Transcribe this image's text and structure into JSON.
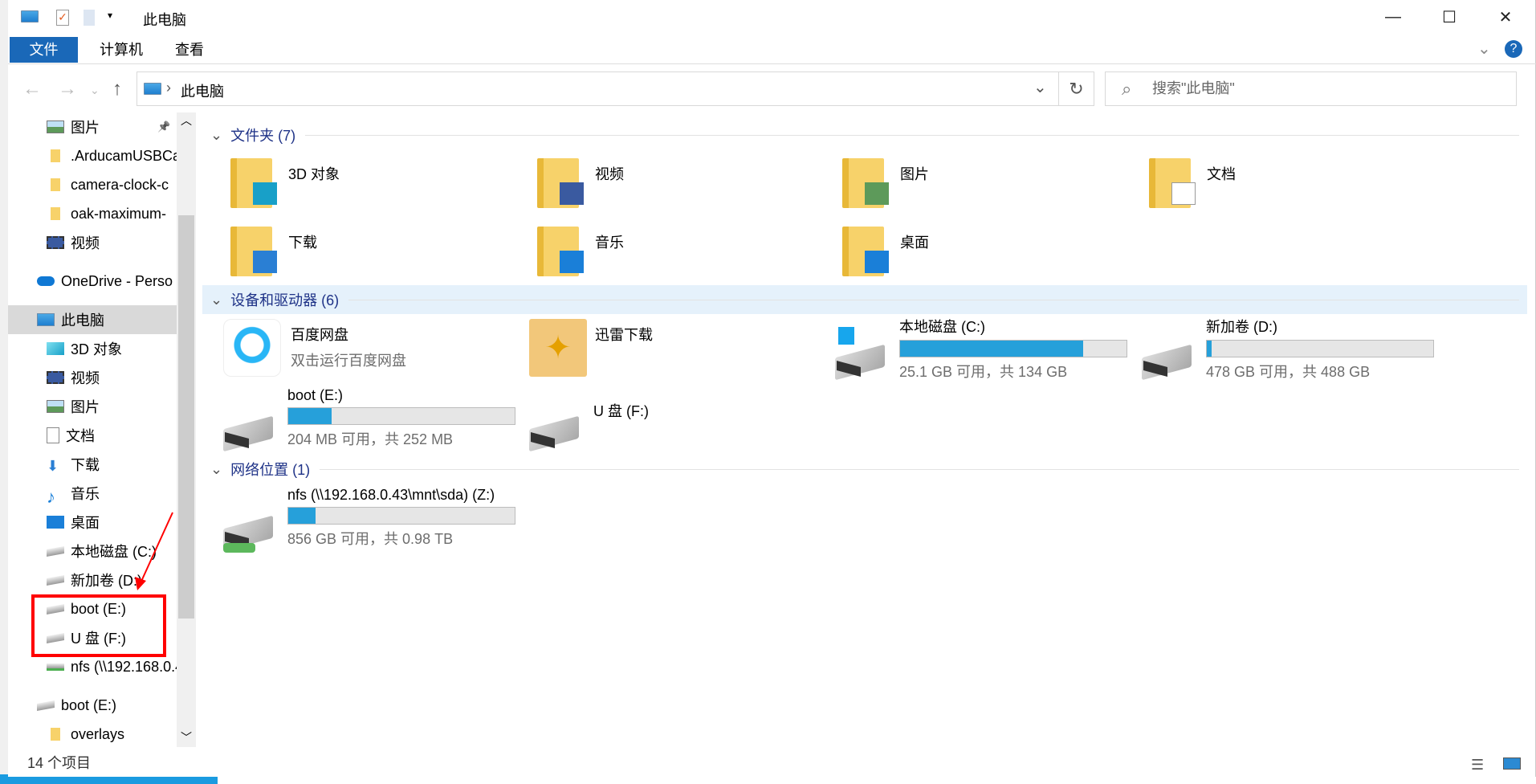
{
  "window": {
    "title": "此电脑",
    "minimize": "—",
    "maximize": "☐",
    "close": "✕"
  },
  "ribbon": {
    "tabs": [
      "文件",
      "计算机",
      "查看"
    ],
    "help": "?",
    "expand": "⌄"
  },
  "address": {
    "path": "此电脑",
    "separator": "›",
    "dropdown": "⌄",
    "refresh": "↻",
    "back": "←",
    "forward": "→",
    "recent": "⌄",
    "up": "↑"
  },
  "search": {
    "placeholder": "搜索\"此电脑\"",
    "icon": "⌕"
  },
  "nav": [
    {
      "label": "图片",
      "icon": "pictures-icon",
      "type": "sub",
      "pinned": true
    },
    {
      "label": ".ArducamUSBCa",
      "icon": "folder-icon",
      "type": "sub"
    },
    {
      "label": "camera-clock-c",
      "icon": "folder-icon",
      "type": "sub"
    },
    {
      "label": "oak-maximum-",
      "icon": "folder-icon",
      "type": "sub"
    },
    {
      "label": "视频",
      "icon": "videos-icon",
      "type": "sub"
    },
    {
      "label": "OneDrive - Perso",
      "icon": "onedrive-icon",
      "type": "root"
    },
    {
      "label": "此电脑",
      "icon": "pc-icon",
      "type": "root",
      "selected": true
    },
    {
      "label": "3D 对象",
      "icon": "3d-objects-icon",
      "type": "sub"
    },
    {
      "label": "视频",
      "icon": "videos-icon",
      "type": "sub"
    },
    {
      "label": "图片",
      "icon": "pictures-icon",
      "type": "sub"
    },
    {
      "label": "文档",
      "icon": "documents-icon",
      "type": "sub"
    },
    {
      "label": "下载",
      "icon": "downloads-icon",
      "type": "sub"
    },
    {
      "label": "音乐",
      "icon": "music-icon",
      "type": "sub"
    },
    {
      "label": "桌面",
      "icon": "desktop-icon",
      "type": "sub"
    },
    {
      "label": "本地磁盘 (C:)",
      "icon": "drive-icon",
      "type": "sub"
    },
    {
      "label": "新加卷 (D:)",
      "icon": "drive-icon",
      "type": "sub"
    },
    {
      "label": "boot (E:)",
      "icon": "drive-icon",
      "type": "sub"
    },
    {
      "label": "U 盘 (F:)",
      "icon": "drive-icon",
      "type": "sub"
    },
    {
      "label": "nfs (\\\\192.168.0.43\\mnt\\sda) (Z:)",
      "icon": "network-drive-icon",
      "type": "sub"
    },
    {
      "label": "boot (E:)",
      "icon": "drive-icon",
      "type": "root"
    },
    {
      "label": "overlays",
      "icon": "folder-icon",
      "type": "sub"
    }
  ],
  "sections": {
    "folders": {
      "title": "文件夹 (7)",
      "items": [
        "3D 对象",
        "视频",
        "图片",
        "文档",
        "下载",
        "音乐",
        "桌面"
      ]
    },
    "devices": {
      "title": "设备和驱动器 (6)"
    },
    "network": {
      "title": "网络位置 (1)"
    }
  },
  "apps": [
    {
      "name": "百度网盘",
      "sub": "双击运行百度网盘"
    },
    {
      "name": "迅雷下载"
    }
  ],
  "drives": [
    {
      "name": "本地磁盘 (C:)",
      "info": "25.1 GB 可用，共 134 GB",
      "used_pct": 81
    },
    {
      "name": "新加卷 (D:)",
      "info": "478 GB 可用，共 488 GB",
      "used_pct": 2
    },
    {
      "name": "boot (E:)",
      "info": "204 MB 可用，共 252 MB",
      "used_pct": 19
    },
    {
      "name": "U 盘 (F:)"
    }
  ],
  "network_drives": [
    {
      "name": "nfs (\\\\192.168.0.43\\mnt\\sda) (Z:)",
      "info": "856 GB 可用，共 0.98 TB",
      "used_pct": 12
    }
  ],
  "status": {
    "count": "14 个项目"
  },
  "colors": {
    "accent": "#1a68b8",
    "bar": "#26a0da",
    "highlight": "#ff0000"
  }
}
